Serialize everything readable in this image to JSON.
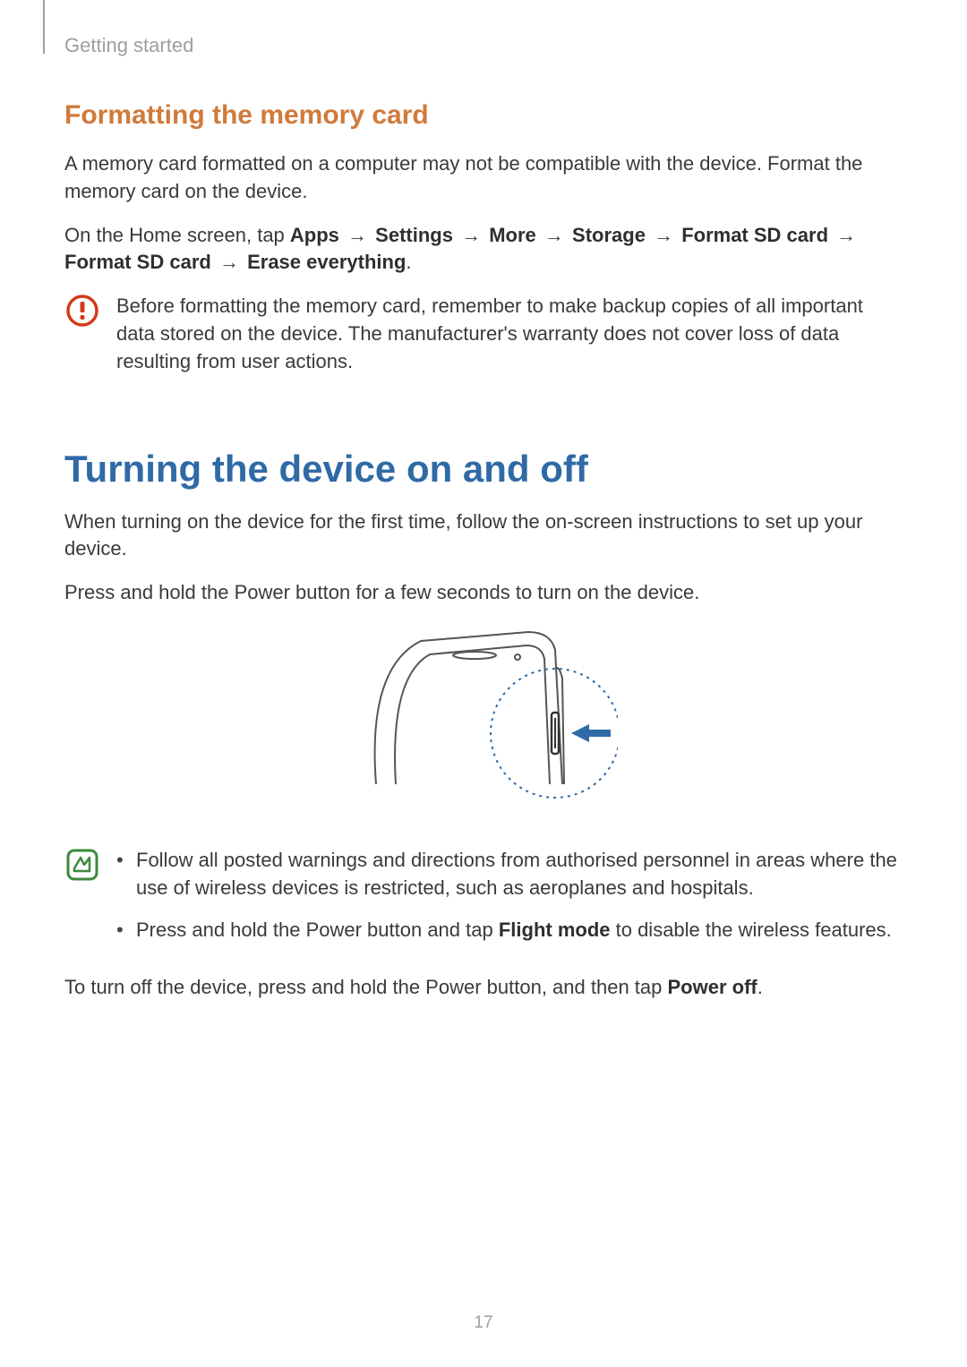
{
  "chapter": "Getting started",
  "section_sub": "Formatting the memory card",
  "para_format_intro": "A memory card formatted on a computer may not be compatible with the device. Format the memory card on the device.",
  "path_intro": "On the Home screen, tap ",
  "path_steps": [
    "Apps",
    "Settings",
    "More",
    "Storage",
    "Format SD card",
    "Format SD card",
    "Erase everything"
  ],
  "arrow_glyph": "→",
  "period": ".",
  "caution_text": "Before formatting the memory card, remember to make backup copies of all important data stored on the device. The manufacturer's warranty does not cover loss of data resulting from user actions.",
  "section_main": "Turning the device on and off",
  "para_turn_intro": "When turning on the device for the first time, follow the on-screen instructions to set up your device.",
  "para_press_hold": "Press and hold the Power button for a few seconds to turn on the device.",
  "tip_bullet1": "Follow all posted warnings and directions from authorised personnel in areas where the use of wireless devices is restricted, such as aeroplanes and hospitals.",
  "tip_bullet2_pre": "Press and hold the Power button and tap ",
  "tip_bullet2_strong": "Flight mode",
  "tip_bullet2_post": " to disable the wireless features.",
  "para_power_off_pre": "To turn off the device, press and hold the Power button, and then tap ",
  "para_power_off_strong": "Power off",
  "page_number": "17"
}
